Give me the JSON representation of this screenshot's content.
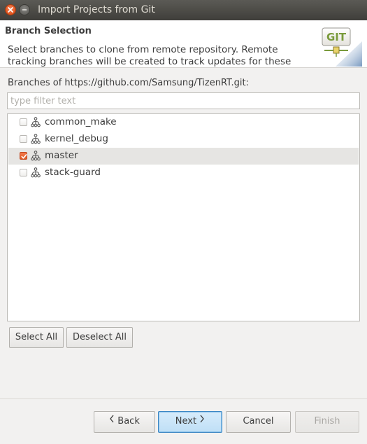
{
  "window": {
    "title": "Import Projects from Git"
  },
  "banner": {
    "title": "Branch Selection",
    "description": "Select branches to clone from remote repository. Remote tracking branches will be created to track updates for these branches in the",
    "logo_text": "GIT"
  },
  "branches": {
    "label": "Branches of https://github.com/Samsung/TizenRT.git:",
    "filter_placeholder": "type filter text",
    "filter_value": "",
    "items": [
      {
        "label": "common_make",
        "checked": false,
        "selected": false
      },
      {
        "label": "kernel_debug",
        "checked": false,
        "selected": false
      },
      {
        "label": "master",
        "checked": true,
        "selected": true
      },
      {
        "label": "stack-guard",
        "checked": false,
        "selected": false
      }
    ]
  },
  "actions": {
    "select_all": "Select All",
    "deselect_all": "Deselect All"
  },
  "footer": {
    "back": "Back",
    "next": "Next",
    "cancel": "Cancel",
    "finish": "Finish",
    "finish_enabled": false,
    "default_button": "next"
  },
  "colors": {
    "accent_checkbox": "#e05a25",
    "default_button_border": "#3c87c4",
    "selected_row": "#e6e5e3"
  }
}
